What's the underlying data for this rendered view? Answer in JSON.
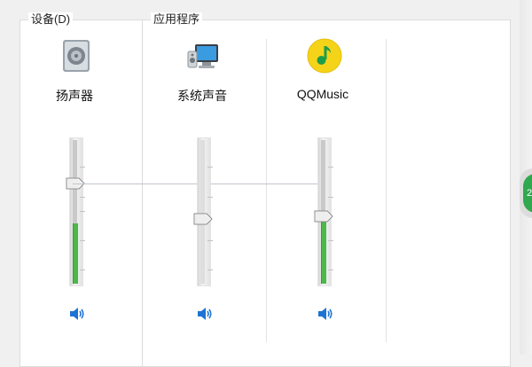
{
  "device_section": {
    "title": "设备(D)"
  },
  "apps_section": {
    "title": "应用程序"
  },
  "channels": [
    {
      "label": "扬声器",
      "icon": "speaker-device-icon",
      "level_pct": 42,
      "peak_pct": 69
    },
    {
      "label": "系统声音",
      "icon": "system-sounds-icon",
      "level_pct": 45
    },
    {
      "label": "QQMusic",
      "icon": "qqmusic-icon",
      "level_pct": 48
    }
  ],
  "edge_badge": {
    "text": "2"
  },
  "colors": {
    "level_fill": "#4cb848",
    "speaker_icon": "#1e73d2",
    "qqmusic_bg": "#f5d319"
  }
}
